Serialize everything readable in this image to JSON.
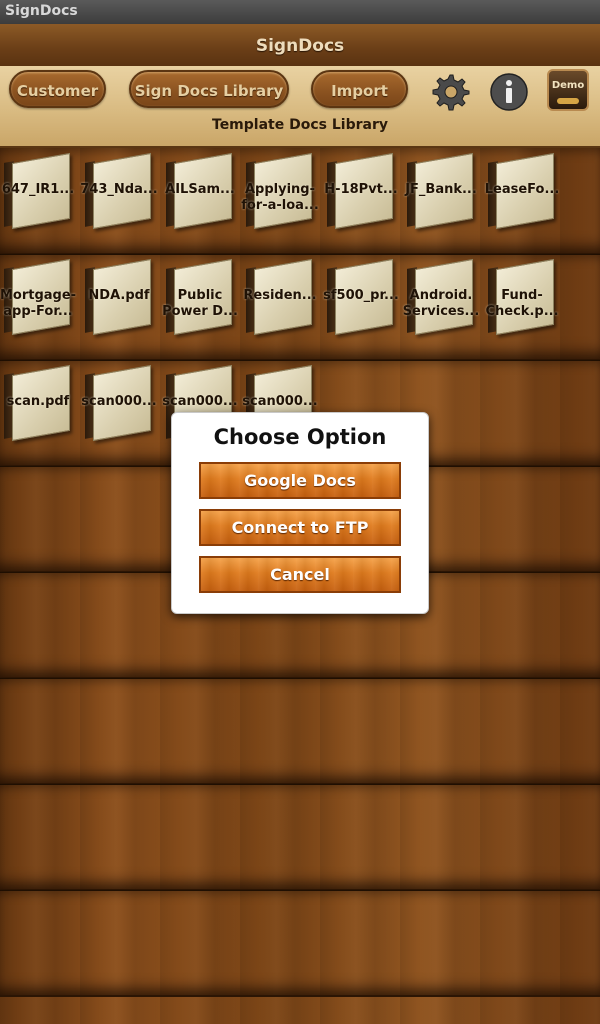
{
  "status_bar": {
    "app_name": "SignDocs"
  },
  "header": {
    "title": "SignDocs"
  },
  "toolbar": {
    "customer_label": "Customer",
    "library_label": "Sign Docs Library",
    "import_label": "Import",
    "demo_label": "Demo",
    "subtitle": "Template Docs Library"
  },
  "shelves": [
    {
      "books": [
        "647_IR1...",
        "743_Nda...",
        "AILSam...",
        "Applying-\nfor-a-loa...",
        "H-18Pvt...",
        "JF_Bank...",
        "LeaseFo..."
      ]
    },
    {
      "books": [
        "Mortgage-\napp-For...",
        "NDA.pdf",
        "Public\nPower D...",
        "Residen...",
        "sf500_pr...",
        "Android.\nServices...",
        "Fund-\nCheck.p..."
      ]
    },
    {
      "books": [
        "scan.pdf",
        "scan000...",
        "scan000...",
        "scan000..."
      ]
    }
  ],
  "dialog": {
    "title": "Choose Option",
    "options": [
      "Google Docs",
      "Connect to FTP",
      "Cancel"
    ]
  },
  "colors": {
    "accent_orange": "#e07b1d",
    "wood_dark": "#6b3a12",
    "toolbar_tan": "#d9bb82"
  }
}
